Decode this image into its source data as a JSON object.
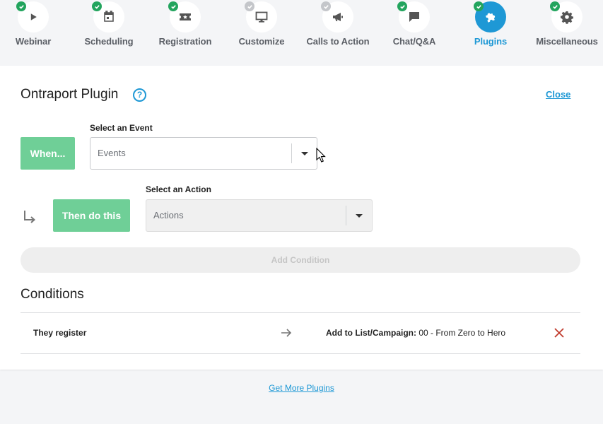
{
  "steps": [
    {
      "label": "Webinar",
      "icon": "play-icon",
      "status": "complete"
    },
    {
      "label": "Scheduling",
      "icon": "calendar-icon",
      "status": "complete"
    },
    {
      "label": "Registration",
      "icon": "ticket-icon",
      "status": "complete"
    },
    {
      "label": "Customize",
      "icon": "monitor-icon",
      "status": "incomplete"
    },
    {
      "label": "Calls to Action",
      "icon": "megaphone-icon",
      "status": "incomplete"
    },
    {
      "label": "Chat/Q&A",
      "icon": "chat-icon",
      "status": "complete"
    },
    {
      "label": "Plugins",
      "icon": "puzzle-icon",
      "status": "complete",
      "active": true
    },
    {
      "label": "Miscellaneous",
      "icon": "gear-icon",
      "status": "complete"
    }
  ],
  "plugin": {
    "title": "Ontraport Plugin",
    "close_label": "Close"
  },
  "event": {
    "trigger_label": "When...",
    "field_label": "Select an Event",
    "placeholder": "Events"
  },
  "action": {
    "trigger_label": "Then do this",
    "field_label": "Select an Action",
    "placeholder": "Actions"
  },
  "add_condition_label": "Add Condition",
  "conditions": {
    "title": "Conditions",
    "rows": [
      {
        "event": "They register",
        "action_label": "Add to List/Campaign:",
        "action_value": " 00 - From Zero to Hero"
      }
    ]
  },
  "footer": {
    "more_plugins_label": "Get More Plugins"
  },
  "colors": {
    "accent": "#1e98d5",
    "success": "#22a45d",
    "button_green": "#6fcf97",
    "remove": "#c0392b"
  }
}
